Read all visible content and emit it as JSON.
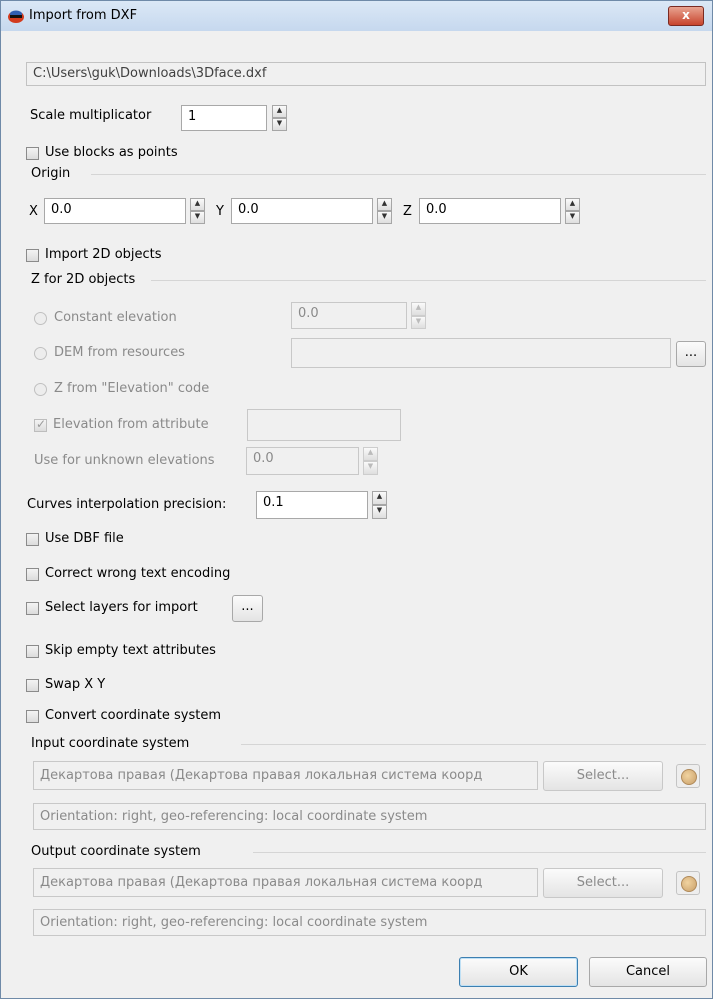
{
  "window": {
    "title": "Import from DXF",
    "close_label": "x"
  },
  "file_path": "C:\\Users\\guk\\Downloads\\3Dface.dxf",
  "scale": {
    "label": "Scale multiplicator",
    "value": "1"
  },
  "use_blocks": {
    "label": "Use blocks as points",
    "checked": false
  },
  "origin": {
    "group_label": "Origin",
    "x_label": "X",
    "x_value": "0.0",
    "y_label": "Y",
    "y_value": "0.0",
    "z_label": "Z",
    "z_value": "0.0"
  },
  "import_2d": {
    "label": "Import 2D objects",
    "checked": false
  },
  "z2d": {
    "group_label": "Z for 2D objects",
    "constant_label": "Constant elevation",
    "constant_value": "0.0",
    "dem_label": "DEM from resources",
    "dem_value": "",
    "dem_browse": "...",
    "zcode_label": "Z from \"Elevation\" code",
    "attr_label": "Elevation from attribute",
    "attr_checked": true,
    "attr_value": "",
    "unknown_label": "Use for unknown elevations",
    "unknown_value": "0.0"
  },
  "curves": {
    "label": "Curves interpolation precision:",
    "value": "0.1"
  },
  "use_dbf": {
    "label": "Use DBF file",
    "checked": false
  },
  "correct_encoding": {
    "label": "Correct wrong text encoding",
    "checked": false
  },
  "select_layers": {
    "label": "Select layers for import",
    "browse": "...",
    "checked": false
  },
  "skip_empty": {
    "label": "Skip empty text attributes",
    "checked": false
  },
  "swap_xy": {
    "label": "Swap X Y",
    "checked": false
  },
  "convert_cs": {
    "label": "Convert coordinate system",
    "checked": false
  },
  "input_cs": {
    "group_label": "Input coordinate system",
    "name": "Декартова правая (Декартова правая локальная система коорд",
    "select_label": "Select...",
    "icon": "globe-icon",
    "description": "Orientation: right, geo-referencing: local coordinate system"
  },
  "output_cs": {
    "group_label": "Output coordinate system",
    "name": "Декартова правая (Декартова правая локальная система коорд",
    "select_label": "Select...",
    "icon": "globe-icon",
    "description": "Orientation: right, geo-referencing: local coordinate system"
  },
  "buttons": {
    "ok": "OK",
    "cancel": "Cancel"
  }
}
